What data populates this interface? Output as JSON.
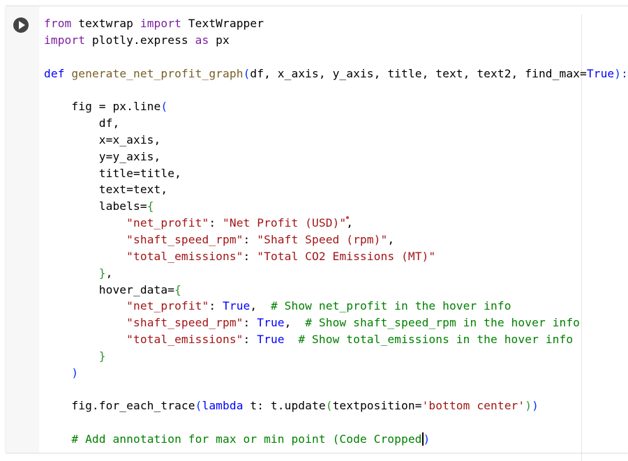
{
  "cell": {
    "run_button": "run-cell"
  },
  "lines": [
    [
      {
        "t": "from",
        "c": "kw"
      },
      {
        "t": " textwrap ",
        "c": ""
      },
      {
        "t": "import",
        "c": "kw"
      },
      {
        "t": " TextWrapper",
        "c": ""
      }
    ],
    [
      {
        "t": "import",
        "c": "kw"
      },
      {
        "t": " plotly.express ",
        "c": ""
      },
      {
        "t": "as",
        "c": "kw"
      },
      {
        "t": " px",
        "c": ""
      }
    ],
    [],
    [
      {
        "t": "def",
        "c": "kw2"
      },
      {
        "t": " ",
        "c": ""
      },
      {
        "t": "generate_net_profit_graph",
        "c": "fn"
      },
      {
        "t": "(",
        "c": "p1"
      },
      {
        "t": "df, x_axis, y_axis, title, text, text2, find_max=",
        "c": ""
      },
      {
        "t": "True",
        "c": "cst"
      },
      {
        "t": "):",
        "c": "p1"
      }
    ],
    [],
    [
      {
        "t": "    fig = px.line",
        "c": ""
      },
      {
        "t": "(",
        "c": "p1"
      }
    ],
    [
      {
        "t": "        df,",
        "c": ""
      }
    ],
    [
      {
        "t": "        x=x_axis,",
        "c": ""
      }
    ],
    [
      {
        "t": "        y=y_axis,",
        "c": ""
      }
    ],
    [
      {
        "t": "        title=title,",
        "c": ""
      }
    ],
    [
      {
        "t": "        text=text,",
        "c": ""
      }
    ],
    [
      {
        "t": "        labels=",
        "c": ""
      },
      {
        "t": "{",
        "c": "p2"
      }
    ],
    [
      {
        "t": "            ",
        "c": ""
      },
      {
        "t": "\"net_profit\"",
        "c": "str"
      },
      {
        "t": ": ",
        "c": ""
      },
      {
        "t": "\"Net Profit (USD)\"",
        "c": "str"
      },
      {
        "t": ",",
        "c": ""
      }
    ],
    [
      {
        "t": "            ",
        "c": ""
      },
      {
        "t": "\"shaft_speed_rpm\"",
        "c": "str"
      },
      {
        "t": ": ",
        "c": ""
      },
      {
        "t": "\"Shaft Speed (rpm)\"",
        "c": "str"
      },
      {
        "t": ",",
        "c": ""
      }
    ],
    [
      {
        "t": "            ",
        "c": ""
      },
      {
        "t": "\"total_emissions\"",
        "c": "str"
      },
      {
        "t": ": ",
        "c": ""
      },
      {
        "t": "\"Total CO2 Emissions (MT)\"",
        "c": "str"
      }
    ],
    [
      {
        "t": "        ",
        "c": ""
      },
      {
        "t": "}",
        "c": "p2"
      },
      {
        "t": ",",
        "c": ""
      }
    ],
    [
      {
        "t": "        hover_data=",
        "c": ""
      },
      {
        "t": "{",
        "c": "p2"
      }
    ],
    [
      {
        "t": "            ",
        "c": ""
      },
      {
        "t": "\"net_profit\"",
        "c": "str"
      },
      {
        "t": ": ",
        "c": ""
      },
      {
        "t": "True",
        "c": "cst"
      },
      {
        "t": ",  ",
        "c": ""
      },
      {
        "t": "# Show net_profit in the hover info",
        "c": "cm"
      }
    ],
    [
      {
        "t": "            ",
        "c": ""
      },
      {
        "t": "\"shaft_speed_rpm\"",
        "c": "str"
      },
      {
        "t": ": ",
        "c": ""
      },
      {
        "t": "True",
        "c": "cst"
      },
      {
        "t": ",  ",
        "c": ""
      },
      {
        "t": "# Show shaft_speed_rpm in the hover info",
        "c": "cm"
      }
    ],
    [
      {
        "t": "            ",
        "c": ""
      },
      {
        "t": "\"total_emissions\"",
        "c": "str"
      },
      {
        "t": ": ",
        "c": ""
      },
      {
        "t": "True",
        "c": "cst"
      },
      {
        "t": "  ",
        "c": ""
      },
      {
        "t": "# Show total_emissions in the hover info",
        "c": "cm"
      }
    ],
    [
      {
        "t": "        ",
        "c": ""
      },
      {
        "t": "}",
        "c": "p2"
      }
    ],
    [
      {
        "t": "    ",
        "c": ""
      },
      {
        "t": ")",
        "c": "p1"
      }
    ],
    [],
    [
      {
        "t": "    fig.for_each_trace",
        "c": ""
      },
      {
        "t": "(",
        "c": "p1"
      },
      {
        "t": "lambda",
        "c": "kw2"
      },
      {
        "t": " t: t.update",
        "c": ""
      },
      {
        "t": "(",
        "c": "p2"
      },
      {
        "t": "textposition=",
        "c": ""
      },
      {
        "t": "'bottom center'",
        "c": "str"
      },
      {
        "t": ")",
        "c": "p2"
      },
      {
        "t": ")",
        "c": "p1"
      }
    ],
    [],
    [
      {
        "t": "    ",
        "c": ""
      },
      {
        "t": "# Add annotation for max or min point (Code Cropped",
        "c": "cm"
      },
      {
        "t": "CARET",
        "c": "caret"
      },
      {
        "t": ")",
        "c": "p1"
      }
    ]
  ]
}
